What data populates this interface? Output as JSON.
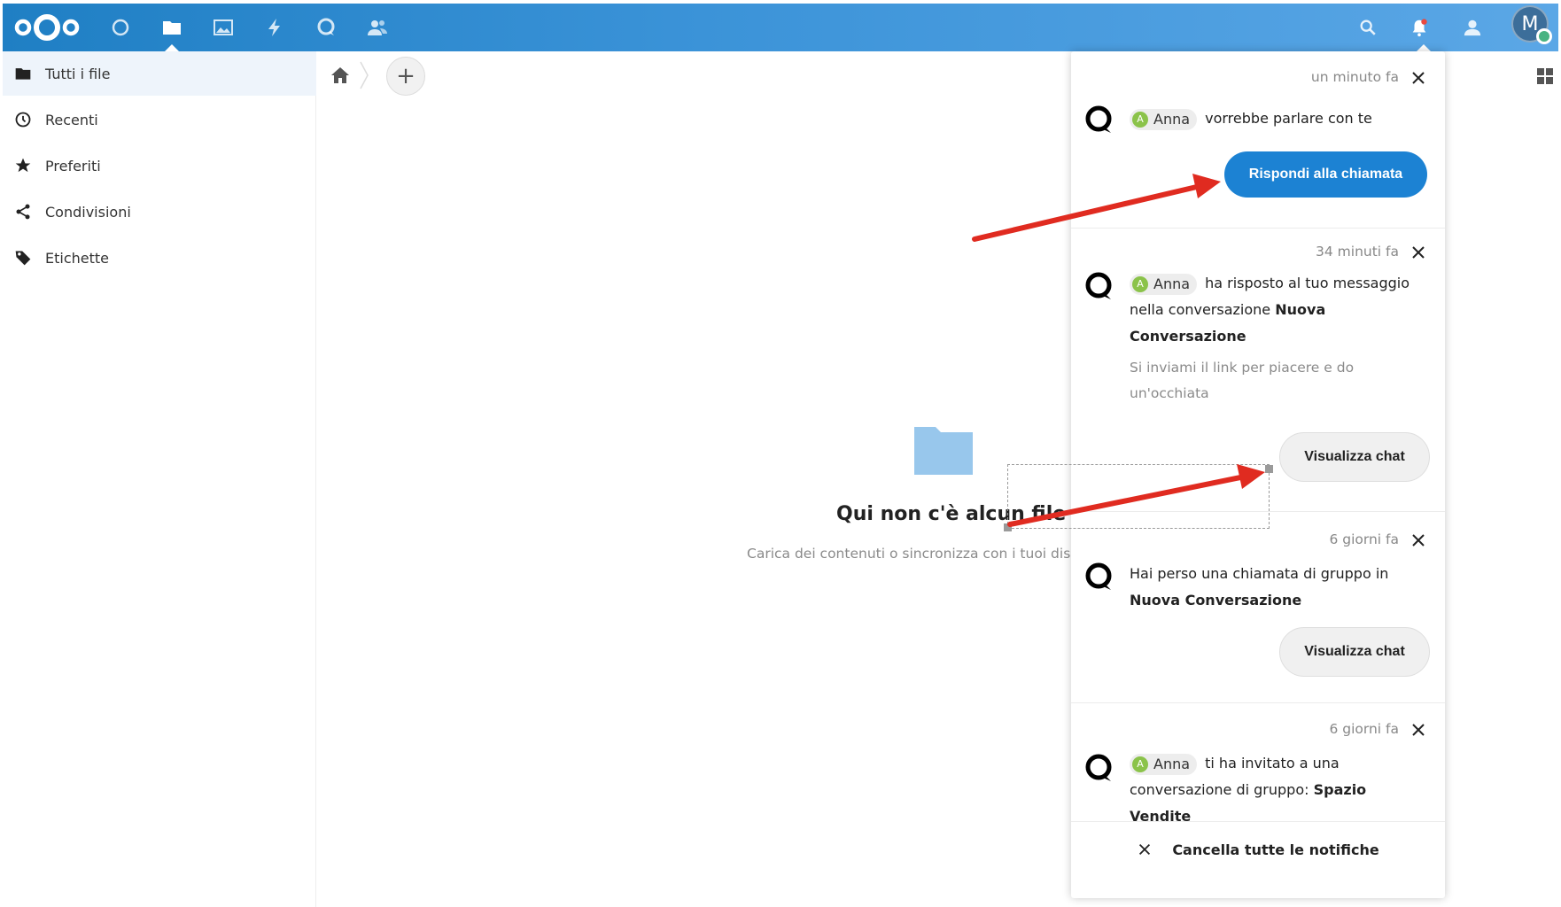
{
  "header": {
    "apps": [
      {
        "name": "dashboard",
        "icon": "circle-icon"
      },
      {
        "name": "files",
        "icon": "folder-icon",
        "active": true
      },
      {
        "name": "photos",
        "icon": "image-icon"
      },
      {
        "name": "activity",
        "icon": "lightning-icon"
      },
      {
        "name": "talk",
        "icon": "talk-icon"
      },
      {
        "name": "contacts",
        "icon": "contacts-icon"
      }
    ],
    "avatar_initial": "M"
  },
  "sidebar": {
    "items": [
      {
        "label": "Tutti i file",
        "icon": "folder-icon",
        "active": true
      },
      {
        "label": "Recenti",
        "icon": "clock-icon"
      },
      {
        "label": "Preferiti",
        "icon": "star-icon"
      },
      {
        "label": "Condivisioni",
        "icon": "share-icon"
      },
      {
        "label": "Etichette",
        "icon": "tag-icon"
      }
    ]
  },
  "main": {
    "add_label": "+",
    "empty_title": "Qui non c'è alcun file",
    "empty_subtitle": "Carica dei contenuti o sincronizza con i tuoi dispositivi!"
  },
  "notifications": [
    {
      "time": "un minuto fa",
      "actor": "Anna",
      "actor_initial": "A",
      "text": "vorrebbe parlare con te",
      "button": "Rispondi alla chiamata"
    },
    {
      "time": "34 minuti fa",
      "actor": "Anna",
      "actor_initial": "A",
      "text": "ha risposto al tuo messaggio nella conversazione",
      "bold": "Nuova Conversazione",
      "quote": "Si inviami il link per piacere e do un'occhiata",
      "button": "Visualizza chat"
    },
    {
      "time": "6 giorni fa",
      "text": "Hai perso una chiamata di gruppo in",
      "bold": "Nuova Conversazione",
      "button": "Visualizza chat"
    },
    {
      "time": "6 giorni fa",
      "actor": "Anna",
      "actor_initial": "A",
      "text": "ti ha invitato a una conversazione di gruppo:",
      "bold": "Spazio Vendite"
    }
  ],
  "clear_all": "Cancella tutte le notifiche",
  "colors": {
    "header_start": "#1f7fc4",
    "header_end": "#5ba7e6",
    "primary_button": "#1c82d3",
    "annotation_arrow": "#e02b20",
    "online_status": "#49b382"
  }
}
